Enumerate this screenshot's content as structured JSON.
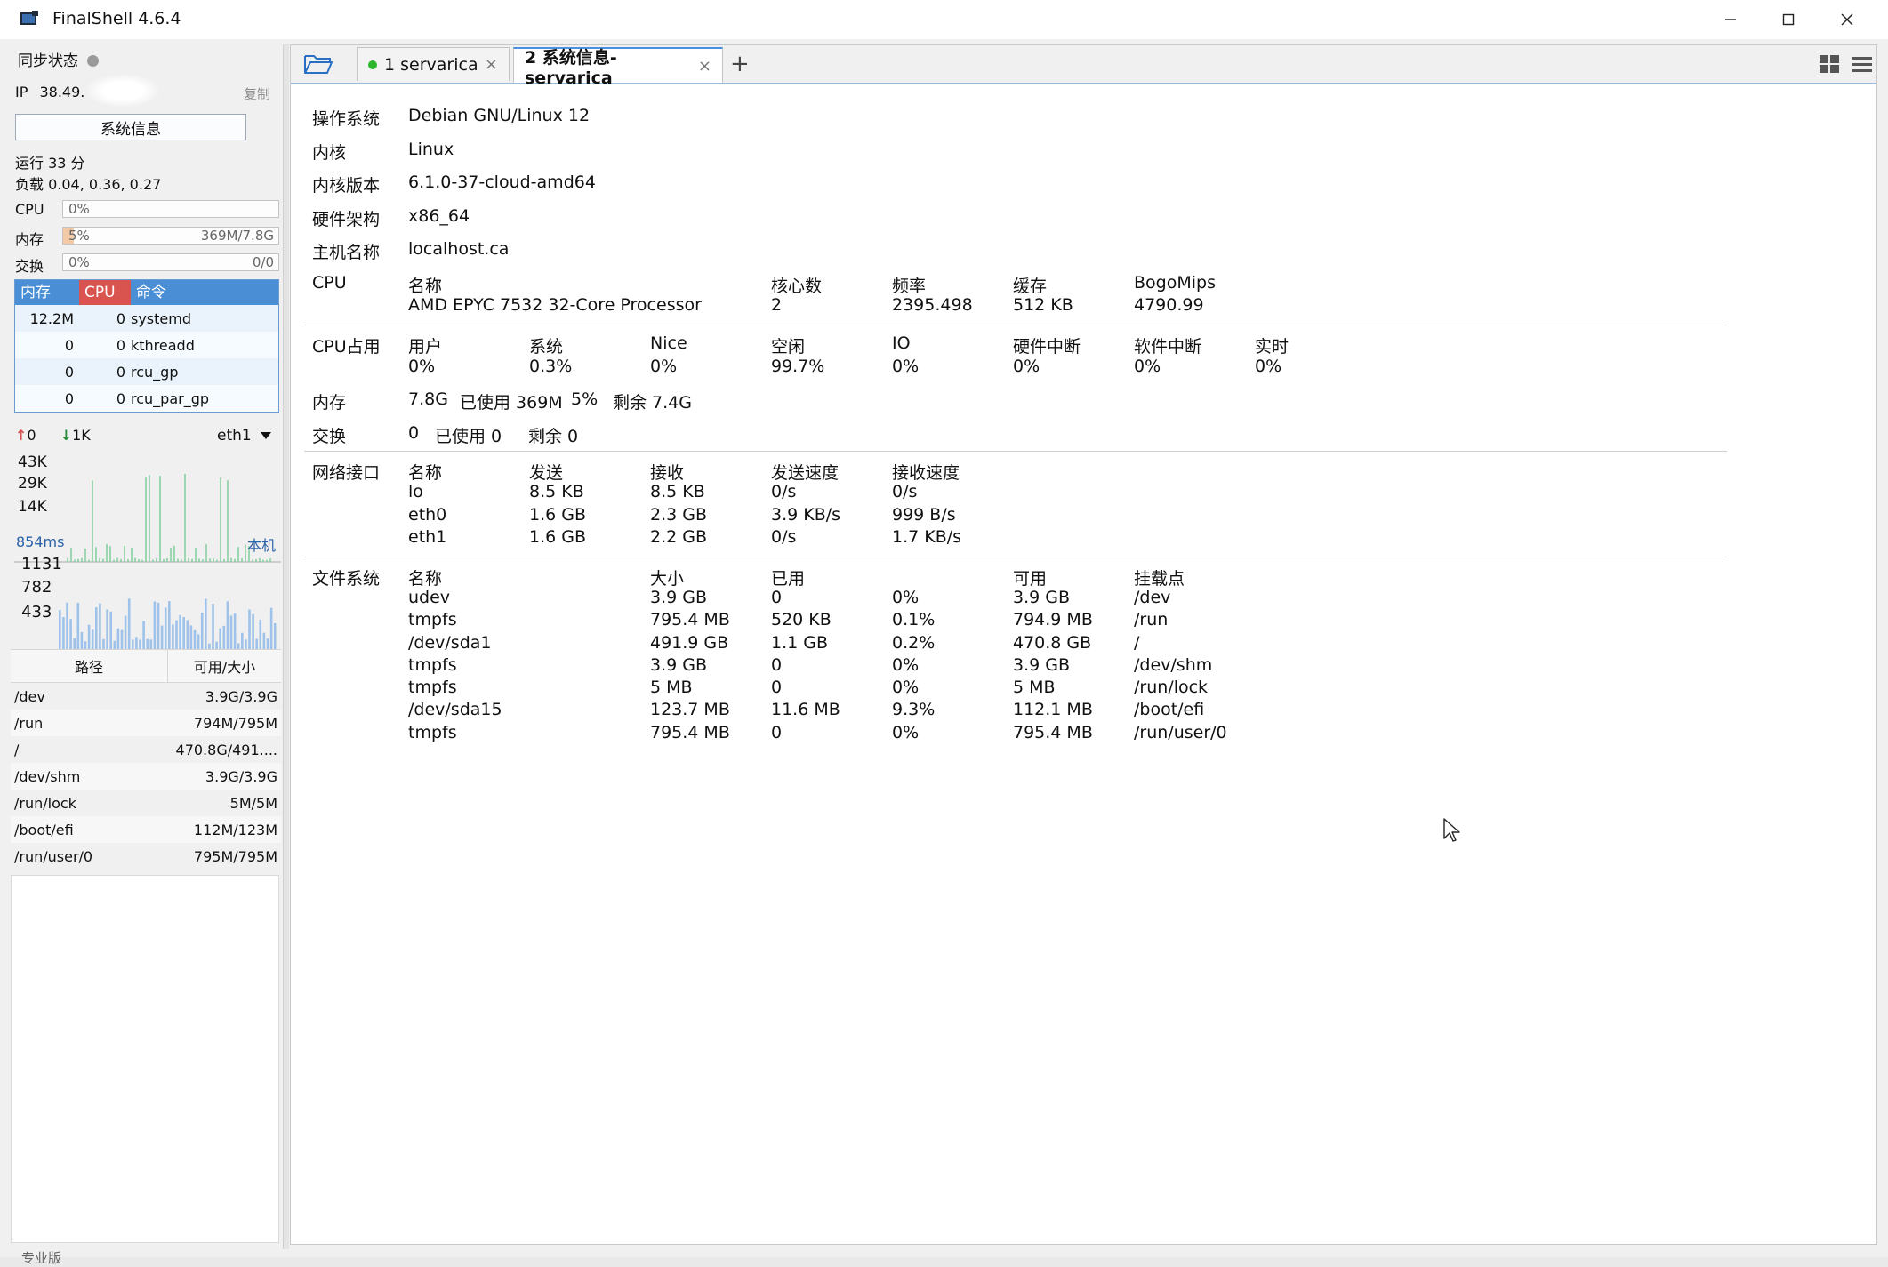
{
  "window": {
    "title": "FinalShell 4.6.4"
  },
  "sidebar": {
    "sync_label": "同步状态",
    "ip_label": "IP",
    "ip_value": "38.49.",
    "copy_label": "复制",
    "sysinfo_button": "系统信息",
    "uptime": "运行 33 分",
    "load": "负载 0.04, 0.36, 0.27",
    "cpu_label": "CPU",
    "cpu_value": "0%",
    "mem_label": "内存",
    "mem_value": "5%",
    "mem_amount": "369M/7.8G",
    "mem_percent": 5,
    "swap_label": "交换",
    "swap_value": "0%",
    "swap_amount": "0/0",
    "process_table": {
      "headers": [
        "内存",
        "CPU",
        "命令"
      ],
      "rows": [
        {
          "mem": "12.2M",
          "cpu": "0",
          "cmd": "systemd"
        },
        {
          "mem": "0",
          "cpu": "0",
          "cmd": "kthreadd"
        },
        {
          "mem": "0",
          "cpu": "0",
          "cmd": "rcu_gp"
        },
        {
          "mem": "0",
          "cpu": "0",
          "cmd": "rcu_par_gp"
        }
      ]
    },
    "net": {
      "up": "0",
      "down": "1K",
      "interface": "eth1",
      "y_labels": [
        "43K",
        "29K",
        "14K"
      ]
    },
    "latency": {
      "ms": "854ms",
      "host": "本机",
      "y_labels": [
        "1131",
        "782",
        "433"
      ]
    },
    "disk_table": {
      "headers": [
        "路径",
        "可用/大小"
      ],
      "rows": [
        {
          "path": "/dev",
          "size": "3.9G/3.9G"
        },
        {
          "path": "/run",
          "size": "794M/795M"
        },
        {
          "path": "/",
          "size": "470.8G/491...."
        },
        {
          "path": "/dev/shm",
          "size": "3.9G/3.9G"
        },
        {
          "path": "/run/lock",
          "size": "5M/5M"
        },
        {
          "path": "/boot/efi",
          "size": "112M/123M"
        },
        {
          "path": "/run/user/0",
          "size": "795M/795M"
        }
      ]
    },
    "edition": "专业版"
  },
  "tabs": [
    {
      "label": "1 servarica",
      "connected": true
    },
    {
      "label": "2 系统信息-servarica",
      "active": true
    }
  ],
  "sysinfo": {
    "os_label": "操作系统",
    "os": "Debian GNU/Linux 12",
    "kernel_label": "内核",
    "kernel": "Linux",
    "kver_label": "内核版本",
    "kver": "6.1.0-37-cloud-amd64",
    "arch_label": "硬件架构",
    "arch": "x86_64",
    "host_label": "主机名称",
    "host": "localhost.ca",
    "cpu": {
      "label": "CPU",
      "h_name": "名称",
      "h_cores": "核心数",
      "h_freq": "频率",
      "h_cache": "缓存",
      "h_bogo": "BogoMips",
      "name": "AMD EPYC 7532 32-Core Processor",
      "cores": "2",
      "freq": "2395.498",
      "cache": "512 KB",
      "bogo": "4790.99"
    },
    "cpu_usage": {
      "label": "CPU占用",
      "headers": [
        "用户",
        "系统",
        "Nice",
        "空闲",
        "IO",
        "硬件中断",
        "软件中断",
        "实时"
      ],
      "values": [
        "0%",
        "0.3%",
        "0%",
        "99.7%",
        "0%",
        "0%",
        "0%",
        "0%"
      ]
    },
    "memory": {
      "label": "内存",
      "total": "7.8G",
      "used": "已使用 369M",
      "percent": "5%",
      "free": "剩余 7.4G"
    },
    "swap": {
      "label": "交换",
      "total": "0",
      "used": "已使用 0",
      "free": "剩余 0"
    },
    "network": {
      "label": "网络接口",
      "headers": [
        "名称",
        "发送",
        "接收",
        "发送速度",
        "接收速度"
      ],
      "rows": [
        [
          "lo",
          "8.5 KB",
          "8.5 KB",
          "0/s",
          "0/s"
        ],
        [
          "eth0",
          "1.6 GB",
          "2.3 GB",
          "3.9 KB/s",
          "999 B/s"
        ],
        [
          "eth1",
          "1.6 GB",
          "2.2 GB",
          "0/s",
          "1.7 KB/s"
        ]
      ]
    },
    "filesystem": {
      "label": "文件系统",
      "headers": [
        "名称",
        "大小",
        "已用",
        "",
        "可用",
        "挂载点"
      ],
      "rows": [
        [
          "udev",
          "3.9 GB",
          "0",
          "0%",
          "3.9 GB",
          "/dev"
        ],
        [
          "tmpfs",
          "795.4 MB",
          "520 KB",
          "0.1%",
          "794.9 MB",
          "/run"
        ],
        [
          "/dev/sda1",
          "491.9 GB",
          "1.1 GB",
          "0.2%",
          "470.8 GB",
          "/"
        ],
        [
          "tmpfs",
          "3.9 GB",
          "0",
          "0%",
          "3.9 GB",
          "/dev/shm"
        ],
        [
          "tmpfs",
          "5 MB",
          "0",
          "0%",
          "5 MB",
          "/run/lock"
        ],
        [
          "/dev/sda15",
          "123.7 MB",
          "11.6 MB",
          "9.3%",
          "112.1 MB",
          "/boot/efi"
        ],
        [
          "tmpfs",
          "795.4 MB",
          "0",
          "0%",
          "795.4 MB",
          "/run/user/0"
        ]
      ]
    }
  },
  "colors": {
    "accent": "#4a90e2",
    "proc_header_blue": "#4a8fd6",
    "proc_header_red": "#d9534f",
    "chart_bar": "#9ec2ea",
    "chart_line": "#7fcf9b"
  },
  "icons": {
    "app": "finalshell-app-icon",
    "folder": "folder-open-icon",
    "grid": "grid-layout-icon",
    "menu": "menu-icon"
  }
}
